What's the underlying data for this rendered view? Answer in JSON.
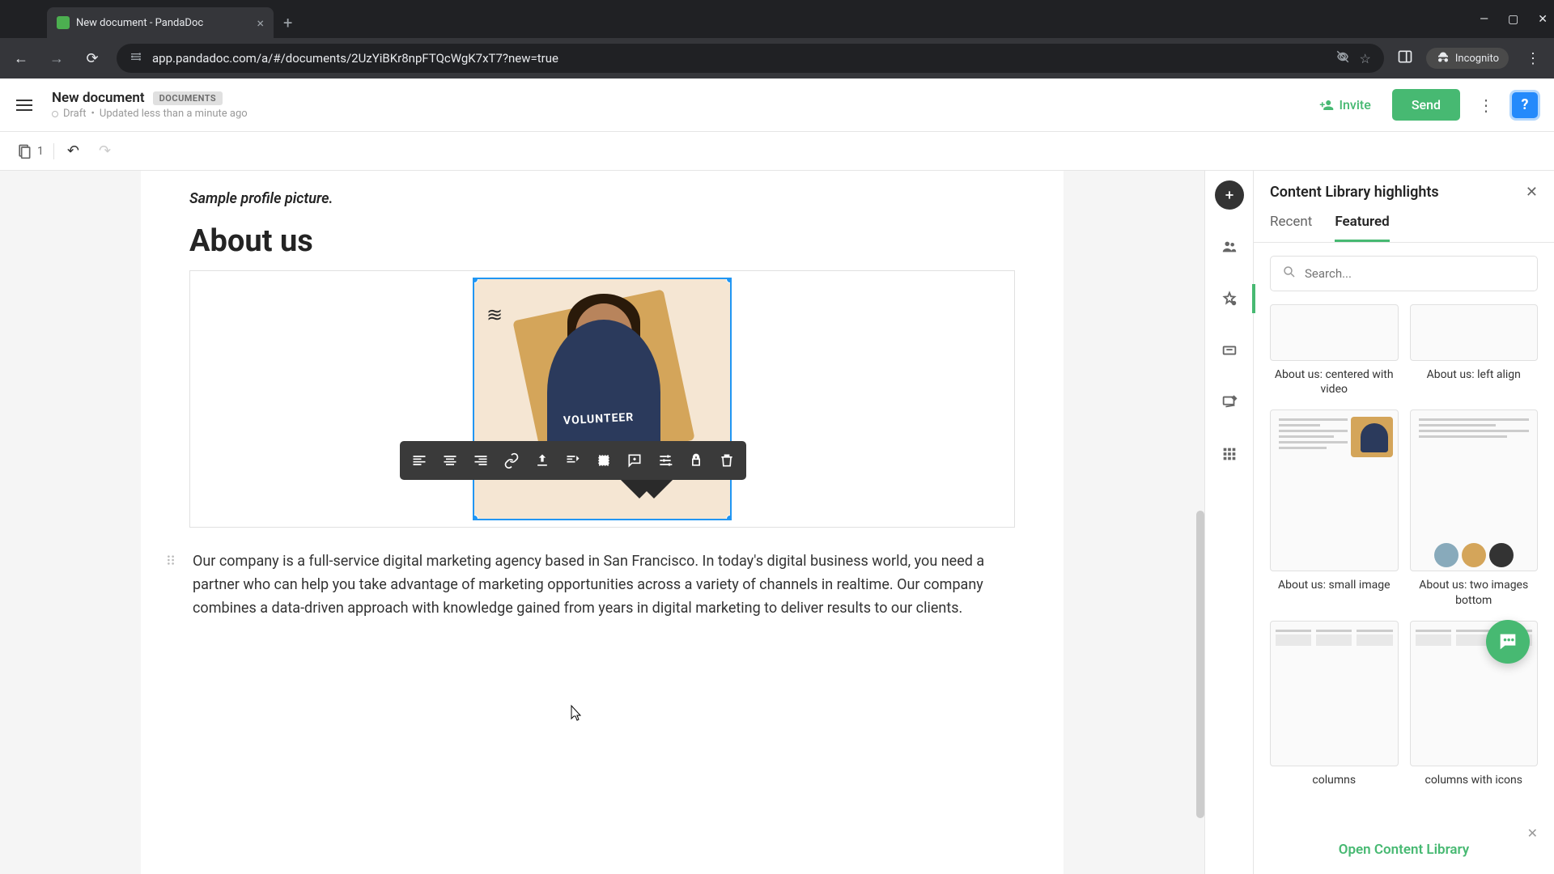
{
  "browser": {
    "tab_title": "New document - PandaDoc",
    "url": "app.pandadoc.com/a/#/documents/2UzYiBKr8npFTQcWgK7xT7?new=true",
    "incognito_label": "Incognito"
  },
  "header": {
    "doc_title": "New document",
    "badge": "DOCUMENTS",
    "status": "Draft",
    "updated": "Updated less than a minute ago",
    "invite_label": "Invite",
    "send_label": "Send"
  },
  "toolbar": {
    "page_num": "1"
  },
  "document": {
    "caption": "Sample profile picture.",
    "heading": "About us",
    "image_shirt_text": "VOLUNTEER",
    "body_text": "Our company is a full-service digital marketing agency based in San Francisco. In today's digital business world, you need a partner who can help you take advantage of marketing opportunities across a variety of channels in realtime. Our company combines a data-driven approach with knowledge gained from years in digital marketing to deliver results to our clients."
  },
  "panel": {
    "title": "Content Library highlights",
    "tabs": {
      "recent": "Recent",
      "featured": "Featured"
    },
    "search_placeholder": "Search...",
    "items": [
      "About us: centered with video",
      "About us: left align",
      "About us: small image",
      "About us: two images bottom",
      "columns",
      "columns with icons"
    ],
    "open_link": "Open Content Library"
  }
}
